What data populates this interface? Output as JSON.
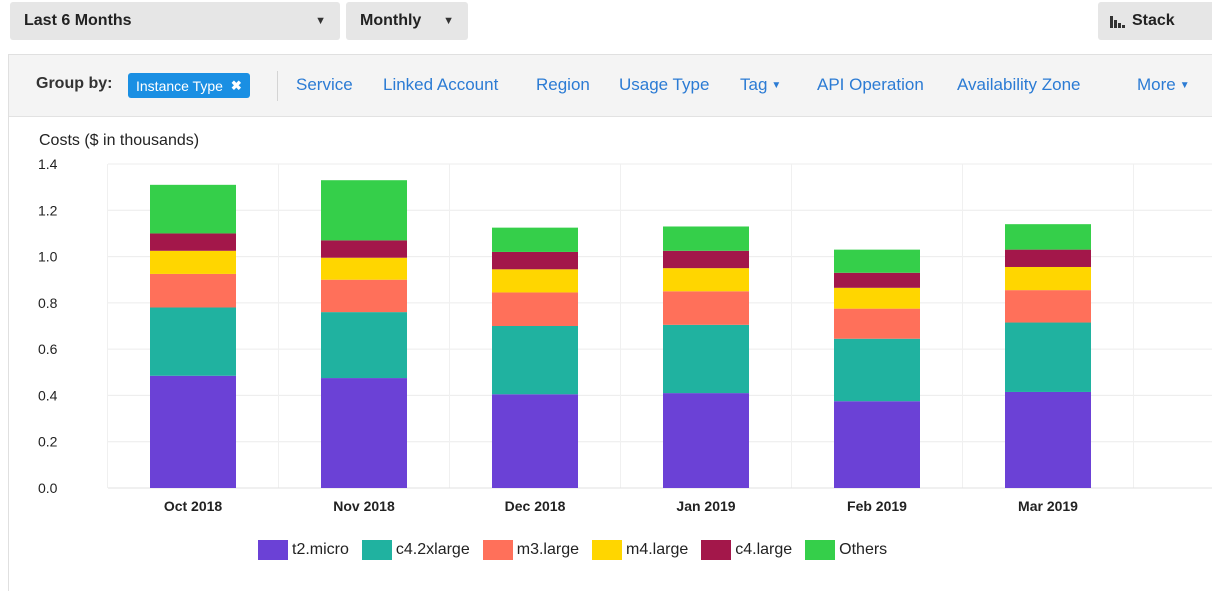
{
  "toolbar": {
    "range_label": "Last 6 Months",
    "granularity_label": "Monthly",
    "chart_style_label": "Stack"
  },
  "group_by": {
    "label": "Group by:",
    "active": "Instance Type",
    "options": [
      "Service",
      "Linked Account",
      "Region",
      "Usage Type",
      "Tag",
      "API Operation",
      "Availability Zone",
      "More"
    ]
  },
  "chart_data": {
    "type": "bar",
    "stacked": true,
    "title": "",
    "ylabel": "Costs ($ in thousands)",
    "xlabel": "",
    "ylim": [
      0,
      1.4
    ],
    "yticks": [
      "0.0",
      "0.2",
      "0.4",
      "0.6",
      "0.8",
      "1.0",
      "1.2",
      "1.4"
    ],
    "grid": true,
    "legend_position": "bottom",
    "categories": [
      "Oct 2018",
      "Nov 2018",
      "Dec 2018",
      "Jan 2019",
      "Feb 2019",
      "Mar 2019"
    ],
    "series": [
      {
        "name": "t2.micro",
        "color": "#6b41d6",
        "values": [
          0.485,
          0.475,
          0.405,
          0.41,
          0.375,
          0.415
        ]
      },
      {
        "name": "c4.2xlarge",
        "color": "#20b2a0",
        "values": [
          0.295,
          0.285,
          0.295,
          0.295,
          0.27,
          0.3
        ]
      },
      {
        "name": "m3.large",
        "color": "#ff705a",
        "values": [
          0.145,
          0.14,
          0.145,
          0.145,
          0.13,
          0.14
        ]
      },
      {
        "name": "m4.large",
        "color": "#ffd600",
        "values": [
          0.1,
          0.095,
          0.1,
          0.1,
          0.09,
          0.1
        ]
      },
      {
        "name": "c4.large",
        "color": "#a3174a",
        "values": [
          0.075,
          0.075,
          0.075,
          0.075,
          0.065,
          0.075
        ]
      },
      {
        "name": "Others",
        "color": "#35cf4a",
        "values": [
          0.21,
          0.26,
          0.105,
          0.105,
          0.1,
          0.11
        ]
      }
    ]
  }
}
